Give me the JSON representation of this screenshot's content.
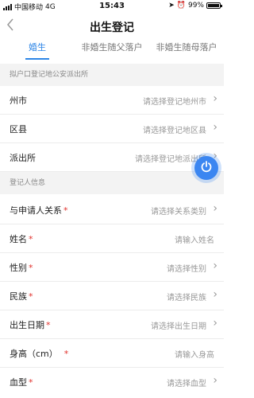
{
  "status_bar": {
    "carrier": "中国移动",
    "network": "4G",
    "time": "15:43",
    "battery_percent": "99%",
    "battery_level": 0.99
  },
  "header": {
    "back_icon": "chevron-left-icon",
    "title": "出生登记"
  },
  "tabs": [
    {
      "label": "婚生",
      "active": true
    },
    {
      "label": "非婚生随父落户",
      "active": false
    },
    {
      "label": "非婚生随母落户",
      "active": false
    }
  ],
  "section1": {
    "title": "拟户口登记地公安派出所",
    "rows": [
      {
        "label": "州市",
        "value": "请选择登记地州市"
      },
      {
        "label": "区县",
        "value": "请选择登记地区县"
      },
      {
        "label": "派出所",
        "value": "请选择登记地派出所"
      }
    ]
  },
  "section2": {
    "title": "登记人信息",
    "rows": [
      {
        "label": "与申请人关系",
        "required": "*",
        "value": "请选择关系类别"
      },
      {
        "label": "姓名",
        "required": "*",
        "value": "请输入姓名"
      },
      {
        "label": "性别",
        "required": "*",
        "value": "请选择性别"
      },
      {
        "label": "民族",
        "required": "*",
        "value": "请选择民族"
      },
      {
        "label": "出生日期",
        "required": "*",
        "value": "请选择出生日期"
      },
      {
        "label": "身高（cm）",
        "required": "*",
        "value": "请输入身高"
      },
      {
        "label": "血型",
        "required": "*",
        "value": "请选择血型"
      }
    ]
  },
  "floating_button": {
    "icon": "power-icon"
  },
  "colors": {
    "accent": "#2e86e6",
    "required": "#e0302b",
    "section_bg": "#f3f3f3"
  }
}
